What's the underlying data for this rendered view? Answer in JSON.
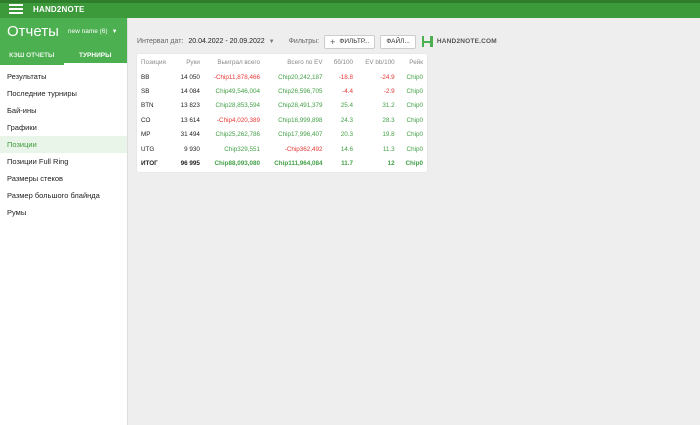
{
  "app": {
    "title": "HAND2NOTE"
  },
  "sidebar": {
    "title": "Отчеты",
    "profile": "new name (6)",
    "tabs": [
      {
        "label": "КЭШ ОТЧЕТЫ"
      },
      {
        "label": "ТУРНИРЫ"
      }
    ],
    "items": [
      {
        "label": "Результаты"
      },
      {
        "label": "Последние турниры"
      },
      {
        "label": "Бай-ины"
      },
      {
        "label": "Графики"
      },
      {
        "label": "Позиции"
      },
      {
        "label": "Позиции Full Ring"
      },
      {
        "label": "Размеры стеков"
      },
      {
        "label": "Размер большого блайнда"
      },
      {
        "label": "Румы"
      }
    ],
    "active_item": "Позиции"
  },
  "toolbar": {
    "interval_label": "Интервал дат:",
    "date_range": "20.04.2022 - 20.09.2022",
    "filters_label": "Фильтры:",
    "filter_button": "ФИЛЬТР...",
    "file_button": "ФАЙЛ...",
    "logo_text": "HAND2NOTE.COM"
  },
  "table": {
    "columns": [
      "Позиция",
      "Руки",
      "Выиграл всего",
      "Всего по EV",
      "бб/100",
      "EV bb/100",
      "Рейк"
    ],
    "rows": [
      {
        "pos": "BB",
        "hands": "14 050",
        "won": "-Chip11,878,466",
        "ev": "Chip20,242,187",
        "bb": "-18.8",
        "evbb": "-24.9",
        "rake": "Chip0"
      },
      {
        "pos": "SB",
        "hands": "14 084",
        "won": "Chip49,546,004",
        "ev": "Chip26,596,705",
        "bb": "-4.4",
        "evbb": "-2.9",
        "rake": "Chip0"
      },
      {
        "pos": "BTN",
        "hands": "13 823",
        "won": "Chip28,853,594",
        "ev": "Chip28,491,379",
        "bb": "25.4",
        "evbb": "31.2",
        "rake": "Chip0"
      },
      {
        "pos": "CO",
        "hands": "13 614",
        "won": "-Chip4,020,389",
        "ev": "Chip18,999,898",
        "bb": "24.3",
        "evbb": "28.3",
        "rake": "Chip0"
      },
      {
        "pos": "MP",
        "hands": "31 494",
        "won": "Chip25,262,786",
        "ev": "Chip17,996,407",
        "bb": "20.3",
        "evbb": "19.8",
        "rake": "Chip0"
      },
      {
        "pos": "UTG",
        "hands": "9 930",
        "won": "Chip329,551",
        "ev": "-Chip362,492",
        "bb": "14.6",
        "evbb": "11.3",
        "rake": "Chip0"
      }
    ],
    "total": {
      "pos": "ИТОГ",
      "hands": "96 995",
      "won": "Chip88,093,080",
      "ev": "Chip111,964,084",
      "bb": "11.7",
      "evbb": "12",
      "rake": "Chip0"
    }
  },
  "colors": {
    "brand": "#4caf50",
    "positive": "#43a047",
    "negative": "#e53935"
  }
}
